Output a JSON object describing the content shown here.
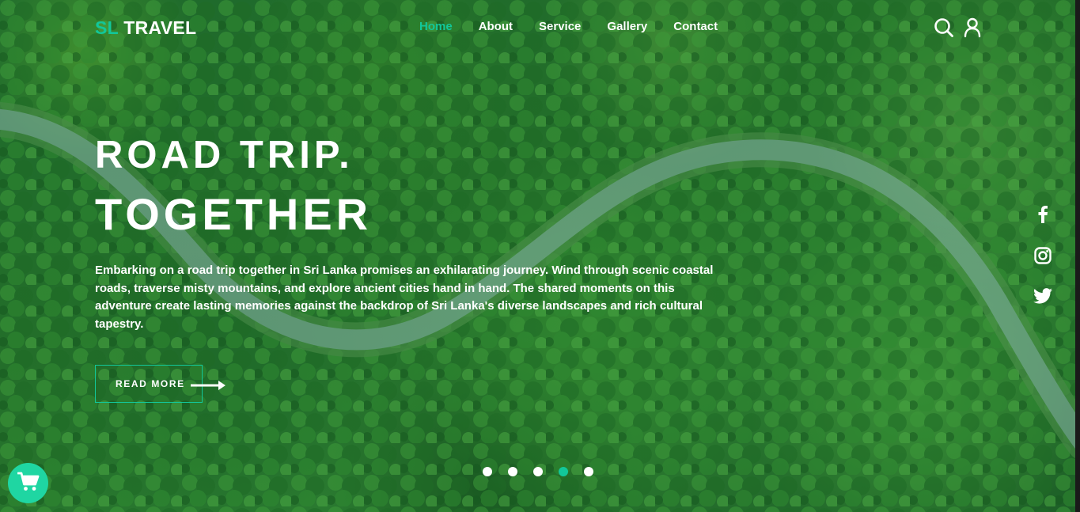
{
  "brand": {
    "logo_accent": "SL",
    "logo_text": "TRAVEL"
  },
  "nav": {
    "items": [
      {
        "label": "Home",
        "active": true
      },
      {
        "label": "About",
        "active": false
      },
      {
        "label": "Service",
        "active": false
      },
      {
        "label": "Gallery",
        "active": false
      },
      {
        "label": "Contact",
        "active": false
      }
    ]
  },
  "header_icons": [
    "search-icon",
    "user-icon"
  ],
  "hero": {
    "title_line1": "ROAD TRIP.",
    "title_line2": "TOGETHER",
    "description": "Embarking on a road trip together in Sri Lanka promises an exhilarating journey. Wind through scenic coastal roads, traverse misty mountains, and explore ancient cities hand in hand. The shared moments on this adventure create lasting memories against the backdrop of Sri Lanka's diverse landscapes and rich cultural tapestry.",
    "cta_label": "READ MORE"
  },
  "social": [
    "facebook-icon",
    "instagram-icon",
    "twitter-icon"
  ],
  "slider": {
    "count": 5,
    "active_index": 3
  },
  "cart": {
    "icon": "cart-icon"
  },
  "colors": {
    "accent": "#12c79a",
    "cart_bg": "#1fd6a2",
    "text": "#ffffff",
    "forest": "#236e2a",
    "road": "#8fb8b0"
  }
}
